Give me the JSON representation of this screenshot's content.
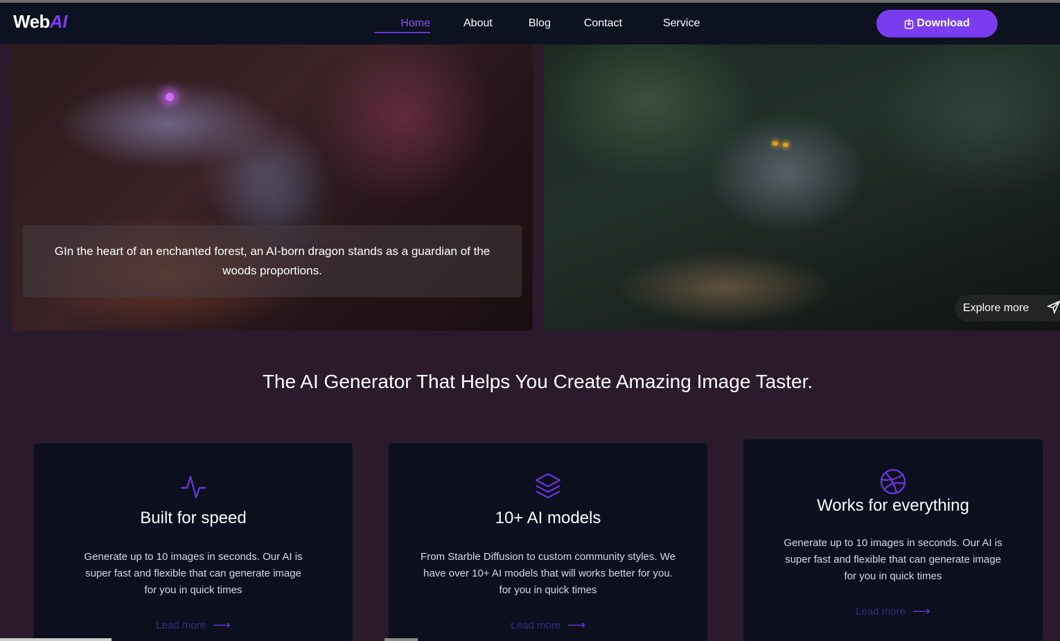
{
  "brand": {
    "name_prefix": "Web",
    "name_suffix": "AI"
  },
  "nav": {
    "items": [
      {
        "label": "Home",
        "active": true
      },
      {
        "label": "About"
      },
      {
        "label": "Blog"
      },
      {
        "label": "Contact"
      },
      {
        "label": "Service"
      }
    ],
    "download_label": "Download"
  },
  "hero": {
    "caption": "GIn the heart of an enchanted forest, an AI-born dragon stands as a guardian of the woods proportions.",
    "explore_label": "Explore more"
  },
  "section": {
    "title": "The AI Generator That Helps You Create Amazing Image Taster."
  },
  "cards": [
    {
      "icon": "activity-icon",
      "title": "Built for speed",
      "text": "Generate up to 10 images in seconds. Our AI is super fast and flexible that can generate image for you in quick times",
      "link": "Lead more"
    },
    {
      "icon": "layers-icon",
      "title": "10+ AI models",
      "text": "From Starble Diffusion to custom community styles. We have over 10+ AI models that will works better for you. for you in quick times",
      "link": "Lead more"
    },
    {
      "icon": "dribbble-icon",
      "title": "Works for everything",
      "text": "Generate up to 10 images in seconds. Our AI is super fast and flexible that can generate image for you in quick times",
      "link": "Lead more"
    }
  ],
  "colors": {
    "accent": "#7b3cf0",
    "nav_bg": "#0d1220",
    "page_bg": "#2a1a2c",
    "card_bg": "#0b0f1e"
  }
}
